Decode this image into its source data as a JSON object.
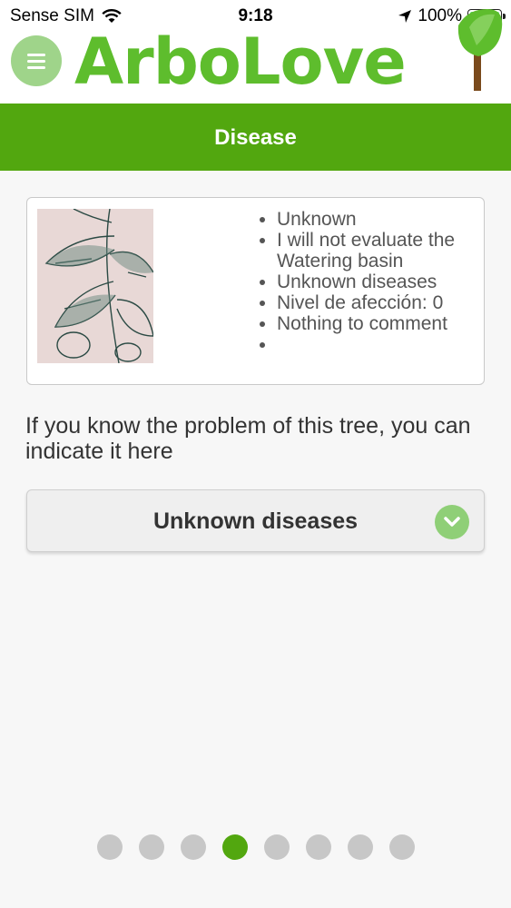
{
  "status_bar": {
    "carrier": "Sense SIM",
    "time": "9:18",
    "battery": "100%"
  },
  "app": {
    "logo_text": "ArboLove"
  },
  "page": {
    "title": "Disease"
  },
  "summary": {
    "items": [
      "Unknown",
      "I will not evaluate the Watering basin",
      "Unknown diseases",
      "Nivel de afección: 0",
      "Nothing to comment",
      ""
    ]
  },
  "prompt": "If you know the problem of this tree, you can indicate it here",
  "disease_select": {
    "value": "Unknown diseases"
  },
  "pager": {
    "total": 8,
    "active_index": 3
  },
  "colors": {
    "brand_green": "#52a70f",
    "logo_green": "#5ebd2d",
    "light_green": "#8fcf77"
  }
}
